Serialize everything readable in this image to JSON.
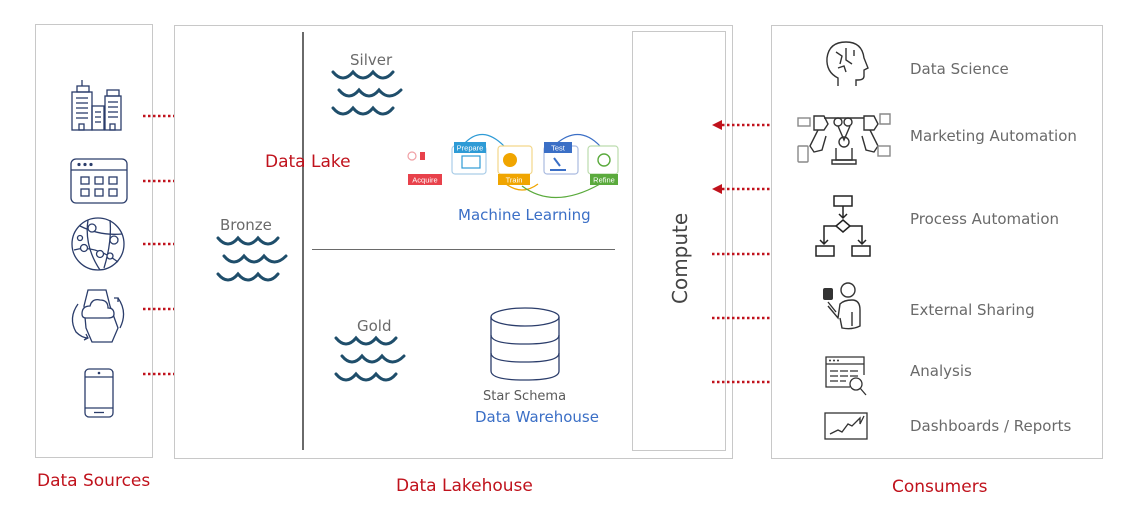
{
  "sections": {
    "data_sources": {
      "title": "Data Sources"
    },
    "data_lakehouse": {
      "title": "Data Lakehouse"
    },
    "consumers": {
      "title": "Consumers"
    }
  },
  "data_sources_icons": [
    "buildings-icon",
    "web-app-icon",
    "network-globe-icon",
    "cloud-sync-icon",
    "mobile-phone-icon"
  ],
  "lakehouse": {
    "data_lake_label": "Data Lake",
    "bronze_label": "Bronze",
    "silver_label": "Silver",
    "gold_label": "Gold",
    "compute_label": "Compute",
    "machine_learning": {
      "title": "Machine Learning",
      "steps": [
        "Acquire",
        "Prepare",
        "Train",
        "Test",
        "Refine"
      ],
      "step_colors": [
        "#e8414b",
        "#2e9bd6",
        "#f0a500",
        "#3b6fc6",
        "#5aaa3c"
      ]
    },
    "warehouse": {
      "schema_label": "Star Schema",
      "title": "Data Warehouse"
    }
  },
  "consumers": [
    {
      "label": "Data Science",
      "icon": "brain-head-icon",
      "arrow": "none"
    },
    {
      "label": "Marketing Automation",
      "icon": "robot-arms-icon",
      "arrow": "bidirectional"
    },
    {
      "label": "Process Automation",
      "icon": "flowchart-icon",
      "arrow": "bidirectional"
    },
    {
      "label": "External Sharing",
      "icon": "person-sharing-icon",
      "arrow": "outbound"
    },
    {
      "label": "Analysis",
      "icon": "document-search-icon",
      "arrow": "outbound"
    },
    {
      "label": "Dashboards / Reports",
      "icon": "line-chart-icon",
      "arrow": "outbound"
    }
  ],
  "colors": {
    "accent_red": "#c0121c",
    "arrow_red": "#c0121c",
    "wave_teal": "#1f4e6b",
    "icon_navy": "#2b3d6b",
    "text_gray": "#6a6a6a",
    "text_blue": "#3b6fc6",
    "border_gray": "#c8c8c8"
  }
}
